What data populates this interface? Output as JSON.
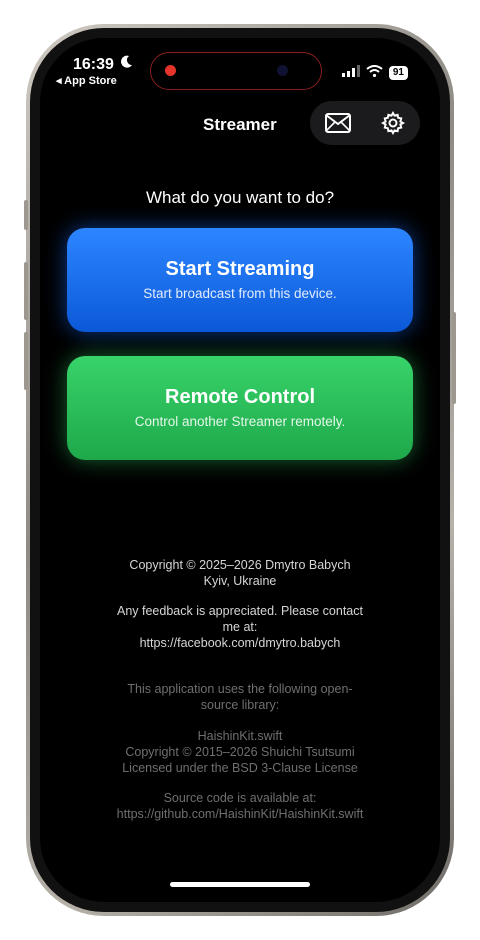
{
  "status_bar": {
    "time": "16:39",
    "back_app": "◂ App Store",
    "battery": "91"
  },
  "nav": {
    "title": "Streamer"
  },
  "main": {
    "prompt": "What do you want to do?",
    "start_streaming": {
      "title": "Start Streaming",
      "subtitle": "Start broadcast from this device."
    },
    "remote_control": {
      "title": "Remote Control",
      "subtitle": "Control another Streamer remotely."
    }
  },
  "footer": {
    "copyright_line": "Copyright © 2025–2026 Dmytro Babych",
    "location": "Kyiv, Ukraine",
    "feedback_line1": "Any feedback is appreciated. Please contact",
    "feedback_line2": "me at:",
    "feedback_link": "https://facebook.com/dmytro.babych",
    "oss_line1": "This application uses the following open-",
    "oss_line2": "source library:",
    "lib_name": "HaishinKit.swift",
    "lib_copyright": "Copyright © 2015–2026 Shuichi Tsutsumi",
    "lib_license": "Licensed under the BSD 3-Clause License",
    "source_line": "Source code is available at:",
    "source_link": "https://github.com/HaishinKit/HaishinKit.swift"
  },
  "colors": {
    "stream_button": "#1a6ff0",
    "remote_button": "#2ac05a",
    "recording_indicator": "#e5352b"
  },
  "icons": [
    "moon-icon",
    "signal-icon",
    "wifi-icon",
    "battery-icon",
    "mail-icon",
    "gear-icon"
  ]
}
